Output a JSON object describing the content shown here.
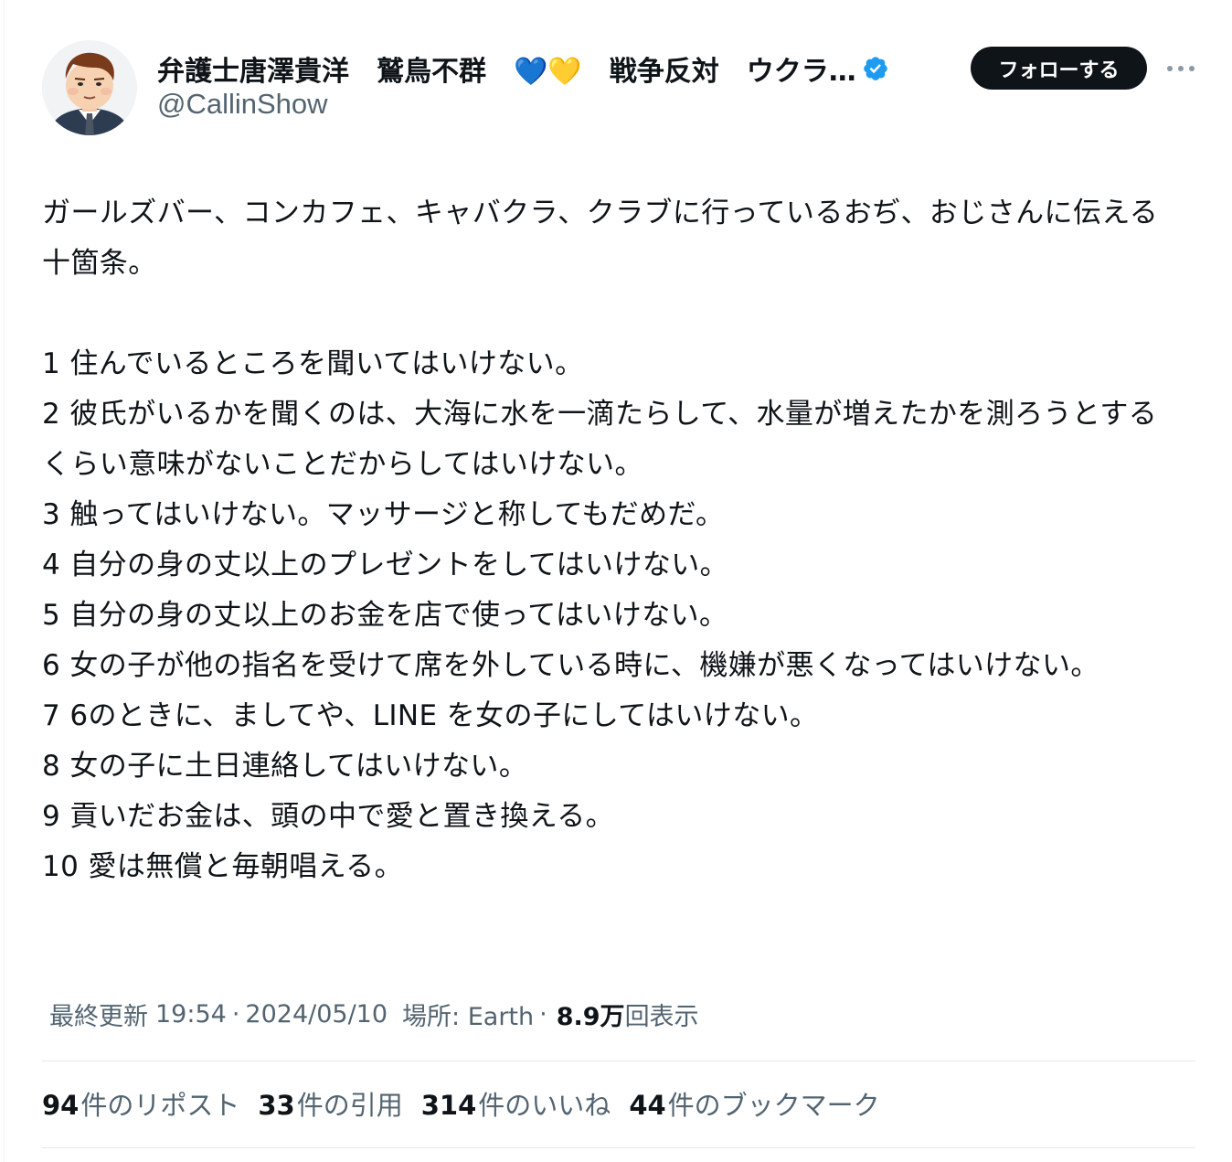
{
  "author": {
    "display_name": "弁護士唐澤貴洋　鷲鳥不群　💙💛　戦争反対　ウクラ…",
    "handle": "@CallinShow",
    "verified_icon": "verified-badge-icon",
    "avatar_icon": "cartoon-avatar"
  },
  "actions": {
    "follow_label": "フォローする",
    "more_icon": "more-dots-icon"
  },
  "tweet": {
    "text": "ガールズバー、コンカフェ、キャバクラ、クラブに行っているおぢ、おじさんに伝える十箇条。\n\n1 住んでいるところを聞いてはいけない。\n2 彼氏がいるかを聞くのは、大海に水を一滴たらして、水量が増えたかを測ろうとするくらい意味がないことだからしてはいけない。\n3 触ってはいけない。マッサージと称してもだめだ。\n4 自分の身の丈以上のプレゼントをしてはいけない。\n5 自分の身の丈以上のお金を店で使ってはいけない。\n6 女の子が他の指名を受けて席を外している時に、機嫌が悪くなってはいけない。\n7 6のときに、ましてや、LINE を女の子にしてはいけない。\n8 女の子に土日連絡してはいけない。\n9 貢いだお金は、頭の中で愛と置き換える。\n10 愛は無償と毎朝唱える。"
  },
  "meta": {
    "updated_label": "最終更新",
    "time": "19:54",
    "dot": "·",
    "date": "2024/05/10",
    "location_label": "場所: Earth",
    "views_number": "8.9万",
    "views_label": "回表示"
  },
  "stats": [
    {
      "number": "94",
      "label": "件のリポスト"
    },
    {
      "number": "33",
      "label": "件の引用"
    },
    {
      "number": "314",
      "label": "件のいいね"
    },
    {
      "number": "44",
      "label": "件のブックマーク"
    }
  ],
  "colors": {
    "text_primary": "#0f1419",
    "text_secondary": "#536471",
    "verified_blue": "#1d9bf0",
    "divider": "#e4e8ea",
    "follow_bg": "#0f1419"
  }
}
